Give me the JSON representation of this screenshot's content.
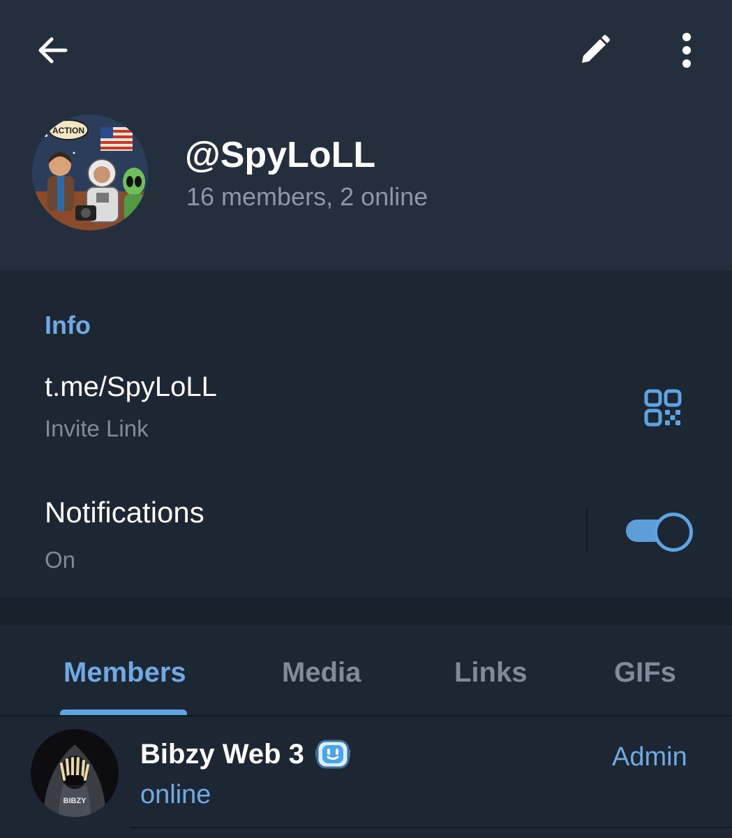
{
  "header": {
    "back_icon": "arrow-left-icon",
    "edit_icon": "pencil-icon",
    "more_icon": "more-vertical-icon",
    "title": "@SpyLoLL",
    "subtitle": "16 members, 2 online",
    "avatar_badge": "ACTION"
  },
  "info": {
    "section_title": "Info",
    "invite_link": "t.me/SpyLoLL",
    "invite_caption": "Invite Link",
    "qr_icon": "qr-code-icon",
    "notifications_label": "Notifications",
    "notifications_status": "On",
    "notifications_enabled": true
  },
  "tabs": [
    {
      "label": "Members",
      "active": true
    },
    {
      "label": "Media",
      "active": false
    },
    {
      "label": "Links",
      "active": false
    },
    {
      "label": "GIFs",
      "active": false
    }
  ],
  "members": [
    {
      "name": "Bibzy Web 3",
      "status": "online",
      "role": "Admin",
      "emoji": "robot-face-emoji",
      "avatar_text": "BIBZY"
    }
  ],
  "colors": {
    "header_bg": "#242f3d",
    "page_bg": "#1d2733",
    "accent": "#71a9e2",
    "secondary_text": "#7f8b98"
  }
}
